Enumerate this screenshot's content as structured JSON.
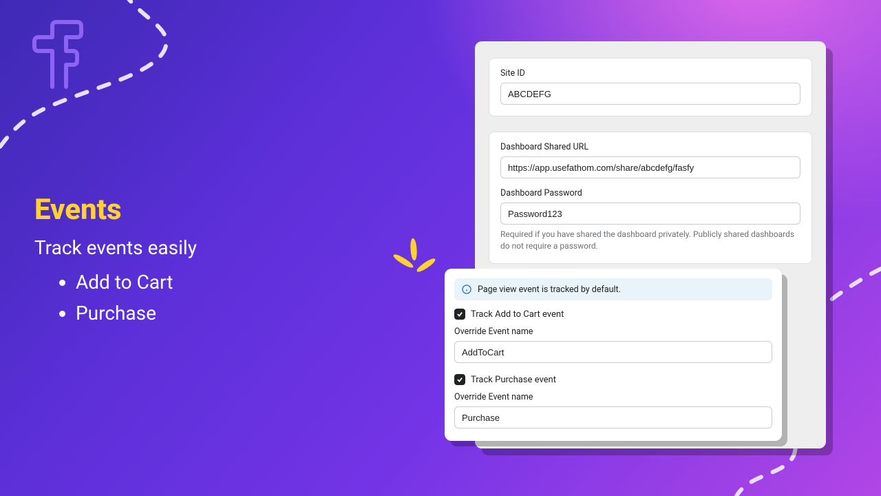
{
  "promo": {
    "title": "Events",
    "subtitle": "Track events easily",
    "items": [
      "Add to Cart",
      "Purchase"
    ]
  },
  "settings": {
    "site_id": {
      "label": "Site ID",
      "value": "ABCDEFG"
    },
    "shared_url": {
      "label": "Dashboard Shared URL",
      "value": "https://app.usefathom.com/share/abcdefg/fasfy"
    },
    "password": {
      "label": "Dashboard Password",
      "value": "Password123",
      "help": "Required if you have shared the dashboard privately. Publicly shared dashboards do not require a password."
    }
  },
  "events": {
    "info": "Page view event is tracked by default.",
    "atc": {
      "checkbox_label": "Track Add to Cart event",
      "override_label": "Override Event name",
      "override_value": "AddToCart"
    },
    "purchase": {
      "checkbox_label": "Track Purchase event",
      "override_label": "Override Event name",
      "override_value": "Purchase"
    }
  }
}
